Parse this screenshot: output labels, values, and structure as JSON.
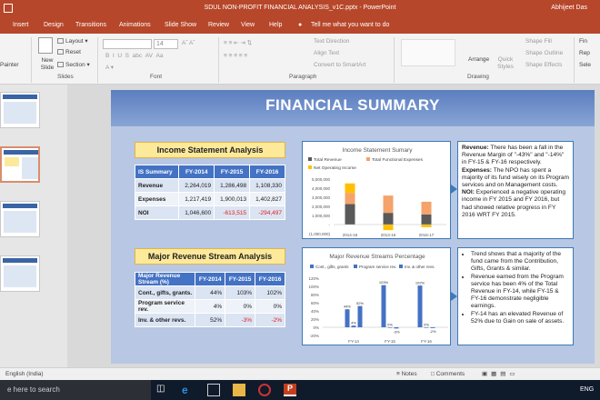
{
  "window": {
    "title": "SDUL NON-PROFIT FINANCIAL ANALYSIS_v1C.pptx - PowerPoint",
    "user": "Abhijeet Das"
  },
  "tabs": [
    "Insert",
    "Design",
    "Transitions",
    "Animations",
    "Slide Show",
    "Review",
    "View",
    "Help"
  ],
  "tell_me": "Tell me what you want to do",
  "ribbon": {
    "clipboard_painter": "Painter",
    "slides": {
      "new_slide": "New Slide",
      "layout": "Layout",
      "reset": "Reset",
      "section": "Section",
      "group_label": "Slides"
    },
    "font": {
      "size": "14",
      "group_label": "Font"
    },
    "paragraph": {
      "text_direction": "Text Direction",
      "align_text": "Align Text",
      "convert_smartart": "Convert to SmartArt",
      "group_label": "Paragraph"
    },
    "drawing": {
      "arrange": "Arrange",
      "quick_styles": "Quick Styles",
      "shape_fill": "Shape Fill",
      "shape_outline": "Shape Outline",
      "shape_effects": "Shape Effects",
      "group_label": "Drawing"
    },
    "editing": {
      "find": "Fin",
      "replace": "Rep",
      "select": "Sele"
    }
  },
  "slide": {
    "title": "FINANCIAL SUMMARY",
    "income": {
      "heading": "Income Statement Analysis",
      "headers": [
        "IS Summary",
        "FY-2014",
        "FY-2015",
        "FY-2016"
      ],
      "rows": [
        {
          "label": "Revenue",
          "values": [
            "2,264,019",
            "1,286,498",
            "1,108,330"
          ]
        },
        {
          "label": "Expenses",
          "values": [
            "1,217,419",
            "1,900,013",
            "1,402,827"
          ]
        },
        {
          "label": "NOI",
          "values": [
            "1,046,600",
            "-613,515",
            "-294,497"
          ]
        }
      ],
      "chart": {
        "title": "Income Statement Sumary",
        "legend": [
          "Total Revenue",
          "Total Functional Expenses",
          "Net Operating Income"
        ],
        "yticks": [
          "5,000,000",
          "4,000,000",
          "3,000,000",
          "2,000,000",
          "1,000,000",
          "-",
          "(1,000,000)"
        ],
        "xticks": [
          "2014-15",
          "2013-16",
          "2016-17"
        ]
      },
      "notes": {
        "revenue_label": "Revenue:",
        "revenue_text": " There has been a fall in the Revenue Margin of \"-43%\" and \"-14%\" in FY-15 & FY-16 respectively.",
        "expenses_label": "Expenses:",
        "expenses_text": " The NPO has spent a majority of its fund wisely on its Program services and on Management costs.",
        "noi_label": "NOI:",
        "noi_text": " Experienced a negative operating income in FY 2015 and FY 2016, but had showed relative progress in FY 2016 WRT FY 2015."
      }
    },
    "revenue": {
      "heading": "Major Revenue Stream Analysis",
      "headers": [
        "Major Revenue Stream (%)",
        "FY-2014",
        "FY-2015",
        "FY-2016"
      ],
      "rows": [
        {
          "label": "Cont., gifts, grants.",
          "values": [
            "44%",
            "103%",
            "102%"
          ]
        },
        {
          "label": "Program service rev.",
          "values": [
            "4%",
            "0%",
            "0%"
          ]
        },
        {
          "label": "Inv. & other revs.",
          "values": [
            "52%",
            "-3%",
            "-2%"
          ]
        }
      ],
      "chart": {
        "title": "Major Revenue Streams Percentage",
        "legend": [
          "Cont., gifts, grants",
          "Program service rev.",
          "Inv. & other revs."
        ],
        "yticks": [
          "120%",
          "100%",
          "80%",
          "60%",
          "40%",
          "20%",
          "0%",
          "-20%"
        ],
        "xticks": [
          "FY-14",
          "FY-15",
          "FY-16"
        ],
        "data_labels": [
          "44%",
          "4%",
          "52%",
          "103%",
          "0%",
          "-3%",
          "102%",
          "0%",
          "-2%"
        ]
      },
      "bullets": [
        "Trend shows that a majority of the fund came from the Contribution, Gifts, Grants & similar.",
        "Revenue earned from the Program service has been 4% of the Total Revenue in FY-14, while FY-15 & FY-16 demonstrate negligible earnings.",
        "FY-14 has an elevated Revenue of 52% due to Gain on sale of assets."
      ]
    }
  },
  "chart_data": [
    {
      "type": "bar",
      "title": "Income Statement Sumary",
      "categories": [
        "2014-15",
        "2013-16",
        "2016-17"
      ],
      "series": [
        {
          "name": "Total Revenue",
          "values": [
            2264019,
            1286498,
            1108330
          ]
        },
        {
          "name": "Total Functional Expenses",
          "values": [
            1217419,
            1900013,
            1402827
          ]
        },
        {
          "name": "Net Operating Income",
          "values": [
            1046600,
            -613515,
            -294497
          ]
        }
      ],
      "stacked": true,
      "ylim": [
        -1000000,
        5000000
      ],
      "colors": [
        "#595959",
        "#f4a36a",
        "#ffc000"
      ]
    },
    {
      "type": "bar",
      "title": "Major Revenue Streams Percentage",
      "categories": [
        "FY-14",
        "FY-15",
        "FY-16"
      ],
      "series": [
        {
          "name": "Cont., gifts, grants",
          "values": [
            44,
            103,
            102
          ]
        },
        {
          "name": "Program service rev.",
          "values": [
            4,
            0,
            0
          ]
        },
        {
          "name": "Inv. & other revs.",
          "values": [
            52,
            -3,
            -2
          ]
        }
      ],
      "ylim": [
        -20,
        120
      ],
      "colors": [
        "#4472c4",
        "#4472c4",
        "#4472c4"
      ]
    }
  ],
  "status": {
    "language": "English (India)",
    "notes": "Notes",
    "comments": "Comments"
  },
  "taskbar": {
    "search": "e here to search",
    "lang": "ENG"
  }
}
